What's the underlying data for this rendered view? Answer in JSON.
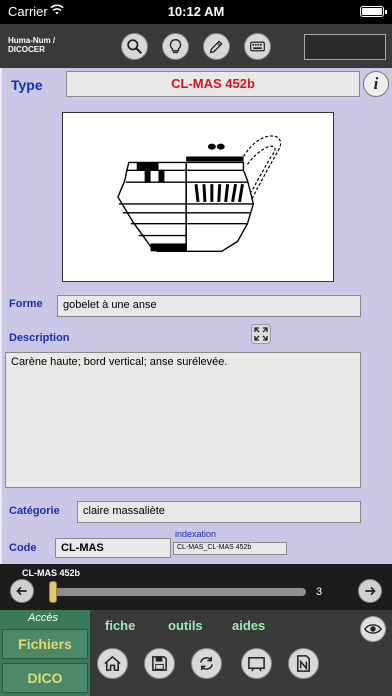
{
  "status_bar": {
    "carrier": "Carrier",
    "time": "10:12 AM"
  },
  "toolbar": {
    "brand_line1": "Huma-Num  /",
    "brand_line2": "DICOCER",
    "icons": [
      "search-icon",
      "lightbulb-icon",
      "pencil-icon",
      "keyboard-icon"
    ]
  },
  "record": {
    "type_label": "Type",
    "type_value": "CL-MAS 452b",
    "info_label": "i",
    "forme_label": "Forme",
    "forme_value": "gobelet à une anse",
    "description_label": "Description",
    "description_value": "Carène haute; bord vertical; anse surélevée.",
    "categorie_label": "Catégorie",
    "categorie_value": "claire massaliète",
    "code_label": "Code",
    "code_value": "CL-MAS",
    "indexation_label": "indexation",
    "indexation_value": "CL-MAS_CL-MAS 452b"
  },
  "navigator": {
    "record_name": "CL-MAS 452b",
    "count": "3",
    "position_fraction": 0.0
  },
  "menu": {
    "acces_label": "Accès",
    "fichiers_label": "Fichiers",
    "dico_label": "DICO",
    "tabs": [
      "fiche",
      "outils",
      "aides"
    ],
    "buttons": [
      "home-icon",
      "save-icon",
      "refresh-icon",
      "screen-icon",
      "notes-icon"
    ]
  }
}
